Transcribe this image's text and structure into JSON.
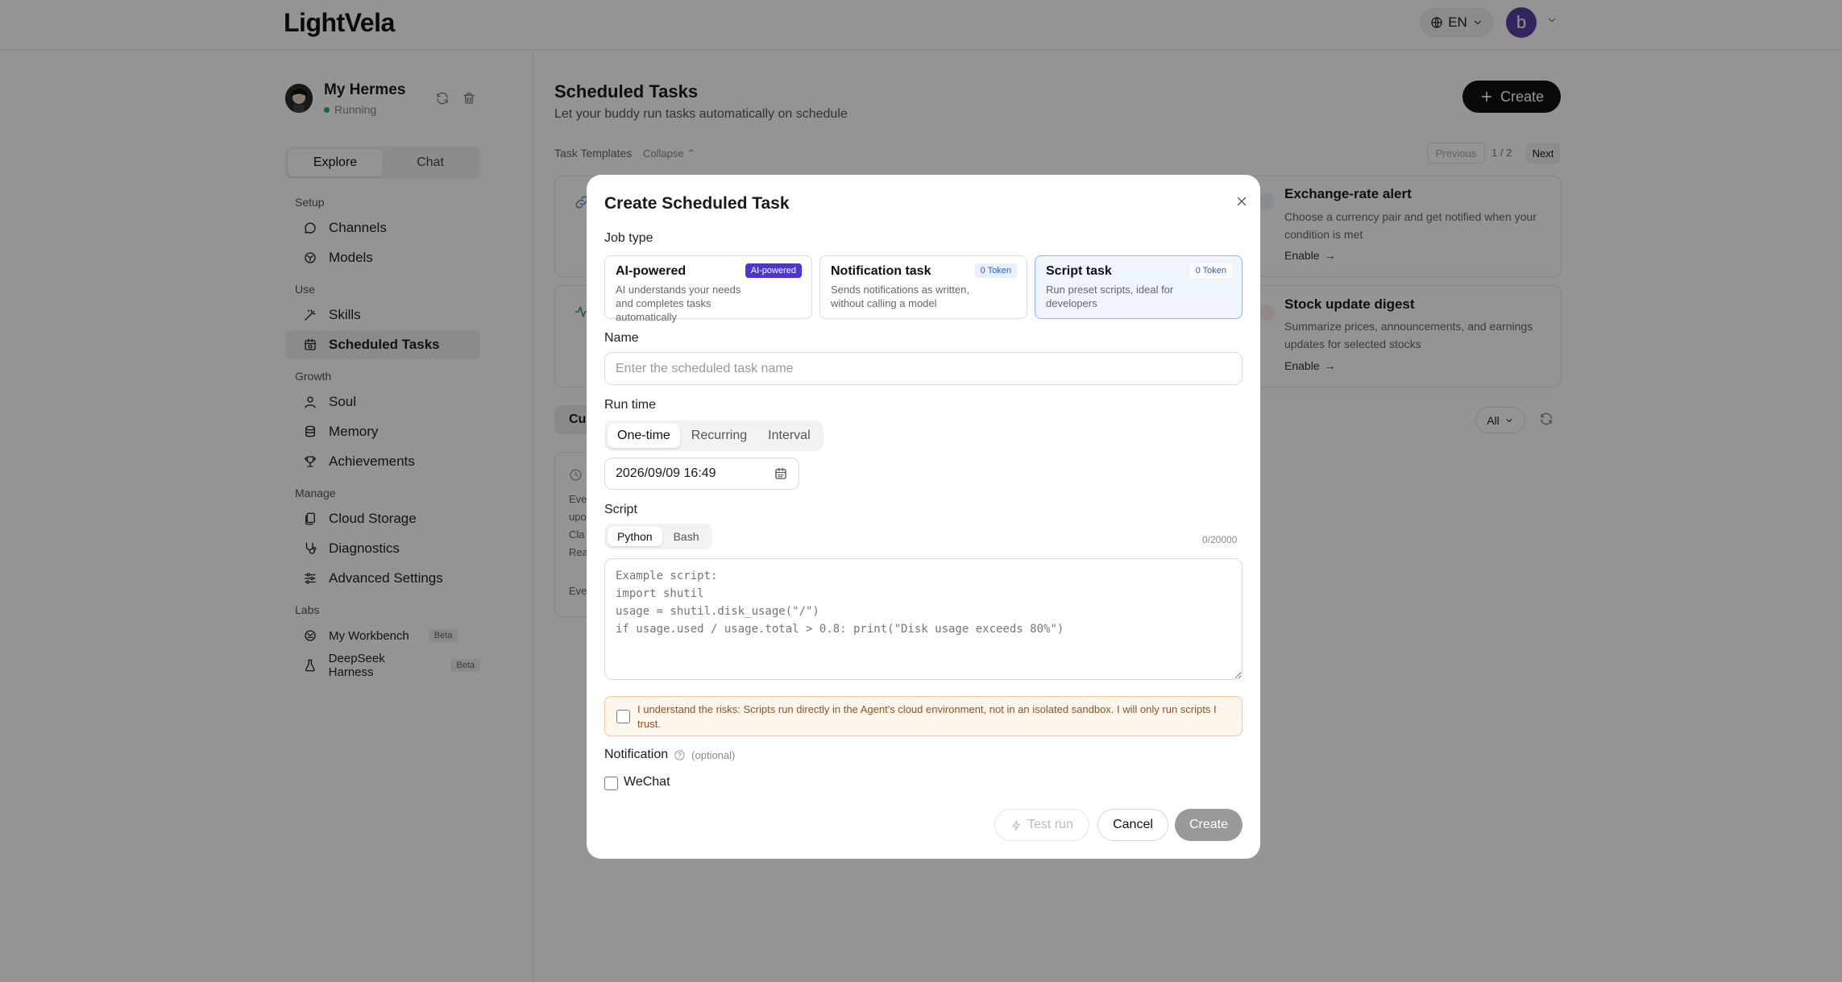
{
  "header": {
    "logo": "LightVela",
    "lang": "EN",
    "avatar_letter": "b"
  },
  "sidebar": {
    "buddy": {
      "name": "My Hermes",
      "status": "Running"
    },
    "tabs": [
      "Explore",
      "Chat"
    ],
    "groups": {
      "setup": "Setup",
      "use": "Use",
      "growth": "Growth",
      "manage": "Manage",
      "labs": "Labs"
    },
    "items": [
      {
        "label": "Channels"
      },
      {
        "label": "Models"
      },
      {
        "label": "Skills"
      },
      {
        "label": "Scheduled Tasks"
      },
      {
        "label": "Soul"
      },
      {
        "label": "Memory"
      },
      {
        "label": "Achievements"
      },
      {
        "label": "Cloud Storage"
      },
      {
        "label": "Diagnostics"
      },
      {
        "label": "Advanced Settings"
      },
      {
        "label": "My Workbench",
        "badge": "Beta"
      },
      {
        "label": "DeepSeek Harness",
        "badge": "Beta"
      }
    ]
  },
  "main": {
    "title": "Scheduled Tasks",
    "subtitle": "Let your buddy run tasks automatically on schedule",
    "create_label": "Create",
    "templates_label": "Task Templates",
    "collapse_label": "Collapse",
    "pager": {
      "prev": "Previous",
      "page": "1 / 2",
      "next": "Next"
    },
    "templates": [
      {
        "title": "Exchange-rate alert",
        "desc": "Choose a currency pair and get notified when your condition is met",
        "action": "Enable"
      },
      {
        "title": "Stock update digest",
        "desc": "Summarize prices, announcements, and earnings updates for selected stocks",
        "action": "Enable"
      }
    ],
    "filter": "All",
    "partial": {
      "tab": "Cu",
      "lines": [
        "Eve",
        "upo",
        "Cla",
        "Rea",
        "Eve"
      ]
    }
  },
  "modal": {
    "title": "Create Scheduled Task",
    "job_type_label": "Job type",
    "job_types": [
      {
        "name": "AI-powered",
        "badge": "AI-powered",
        "desc": "AI understands your needs and completes tasks automatically"
      },
      {
        "name": "Notification task",
        "badge": "0 Token",
        "desc": "Sends notifications as written, without calling a model"
      },
      {
        "name": "Script task",
        "badge": "0 Token",
        "desc": "Run preset scripts, ideal for developers"
      }
    ],
    "name_label": "Name",
    "name_placeholder": "Enter the scheduled task name",
    "run_time_label": "Run time",
    "run_modes": [
      "One-time",
      "Recurring",
      "Interval"
    ],
    "datetime": "2026/09/09 16:49",
    "script_label": "Script",
    "script_langs": [
      "Python",
      "Bash"
    ],
    "char_count": "0/20000",
    "script_placeholder": "Example script:\nimport shutil\nusage = shutil.disk_usage(\"/\")\nif usage.used / usage.total > 0.8: print(\"Disk usage exceeds 80%\")",
    "risk_text": "I understand the risks: Scripts run directly in the Agent's cloud environment, not in an isolated sandbox. I will only run scripts I trust.",
    "notification_label": "Notification",
    "optional": "(optional)",
    "wechat": "WeChat",
    "buttons": {
      "test": "Test run",
      "cancel": "Cancel",
      "create": "Create"
    }
  },
  "colors": {
    "accent": "#4a36d8",
    "selected_bg": "#eef5ff",
    "warning_bg": "#fff6ee",
    "running": "#22b35e"
  }
}
